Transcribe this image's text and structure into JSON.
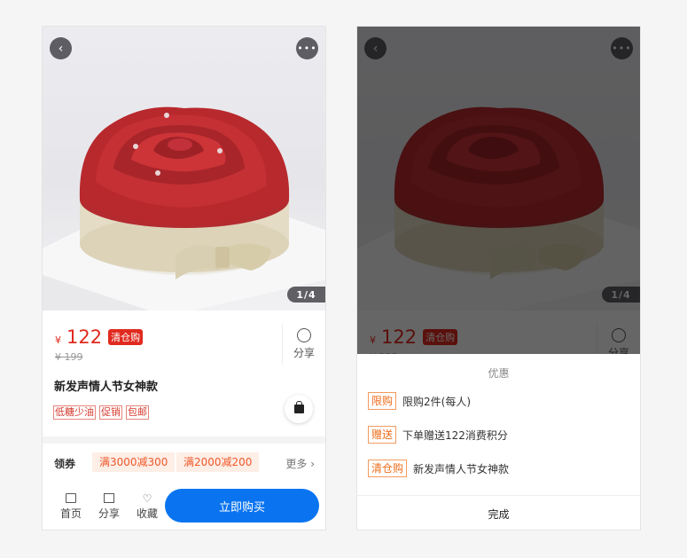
{
  "product": {
    "currency": "¥",
    "price": "122",
    "sale_tag": "清仓购",
    "old_price": "¥ 199",
    "title": "新发声情人节女神款",
    "tags": [
      "低糖少油",
      "促销",
      "包邮"
    ],
    "image_pager": "1/4",
    "share_label": "分享"
  },
  "coupons": {
    "label": "领券",
    "items": [
      "满3000减300",
      "满2000减200"
    ],
    "more": "更多 ›"
  },
  "bottom_bar": {
    "home": "首页",
    "share": "分享",
    "favorite": "收藏",
    "buy": "立即购买"
  },
  "promo_sheet": {
    "title": "优惠",
    "items": [
      {
        "tag": "限购",
        "text": "限购2件(每人)"
      },
      {
        "tag": "赠送",
        "text": "下单赠送122消费积分"
      },
      {
        "tag": "清仓购",
        "text": "新发声情人节女神款"
      }
    ],
    "done": "完成"
  },
  "colors": {
    "accent_red": "#e02a1f",
    "buy_blue": "#0a74f0",
    "promo_orange": "#ee6d1c"
  }
}
